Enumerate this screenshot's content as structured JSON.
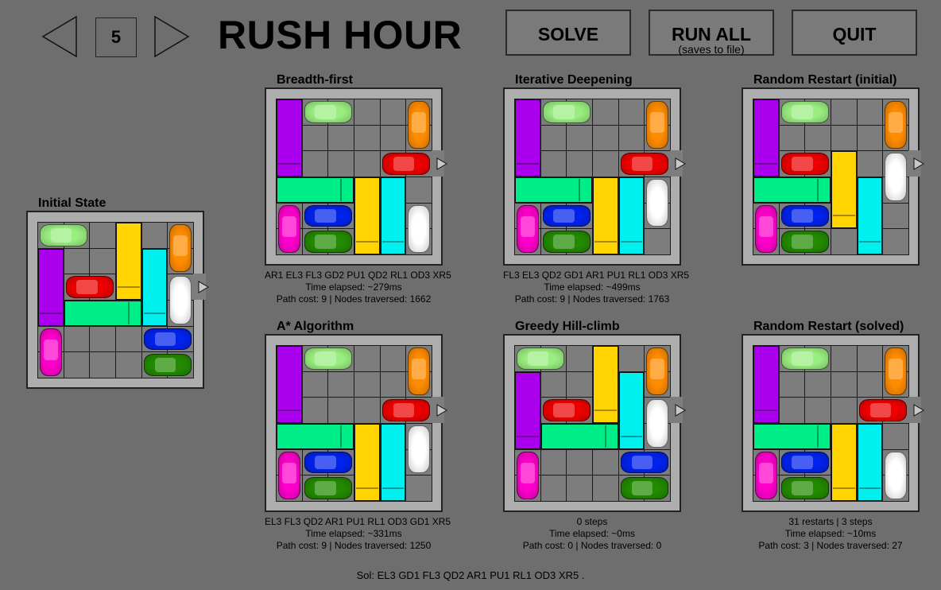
{
  "header": {
    "level": "5",
    "title": "RUSH HOUR",
    "prev_icon": "left-arrow-icon",
    "next_icon": "right-arrow-icon",
    "buttons": {
      "solve": "SOLVE",
      "run_all": "RUN ALL",
      "run_all_sub": "(saves to file)",
      "quit": "QUIT"
    }
  },
  "colors": {
    "X": "#ee0000",
    "A": "#9aee80",
    "B": "#ff8c00",
    "C": "#aa00ee",
    "D": "#ff00cc",
    "E": "#00ee88",
    "F": "#ffd400",
    "G": "#00f0f0",
    "H": "#ffffff",
    "I": "#0022ee",
    "J": "#228b00",
    "board_cell": "#7d7d7d",
    "board_frame": "#adadad",
    "background": "#6e6e6e"
  },
  "boards": [
    {
      "key": "initial",
      "title": "Initial State",
      "info": [],
      "pieces": [
        {
          "id": "A",
          "kind": "car",
          "r": 0,
          "c": 0,
          "o": "h",
          "len": 2
        },
        {
          "id": "C",
          "kind": "truck",
          "r": 1,
          "c": 0,
          "o": "v",
          "len": 3
        },
        {
          "id": "D",
          "kind": "car",
          "r": 4,
          "c": 0,
          "o": "v",
          "len": 2
        },
        {
          "id": "X",
          "kind": "car",
          "r": 2,
          "c": 1,
          "o": "h",
          "len": 2
        },
        {
          "id": "E",
          "kind": "truck",
          "r": 3,
          "c": 1,
          "o": "h",
          "len": 3
        },
        {
          "id": "F",
          "kind": "truck",
          "r": 0,
          "c": 3,
          "o": "v",
          "len": 3
        },
        {
          "id": "G",
          "kind": "truck",
          "r": 1,
          "c": 4,
          "o": "v",
          "len": 3
        },
        {
          "id": "B",
          "kind": "car",
          "r": 0,
          "c": 5,
          "o": "v",
          "len": 2
        },
        {
          "id": "H",
          "kind": "car",
          "r": 2,
          "c": 5,
          "o": "v",
          "len": 2
        },
        {
          "id": "I",
          "kind": "car",
          "r": 4,
          "c": 4,
          "o": "h",
          "len": 2
        },
        {
          "id": "J",
          "kind": "car",
          "r": 5,
          "c": 4,
          "o": "h",
          "len": 2
        }
      ]
    },
    {
      "key": "bfs",
      "title": "Breadth-first",
      "info": [
        "AR1 EL3 FL3 GD2 PU1 QD2 RL1 OD3 XR5",
        "Time elapsed: ~279ms",
        "Path cost: 9 | Nodes traversed: 1662"
      ],
      "pieces": [
        {
          "id": "C",
          "kind": "truck",
          "r": 0,
          "c": 0,
          "o": "v",
          "len": 3
        },
        {
          "id": "A",
          "kind": "car",
          "r": 0,
          "c": 1,
          "o": "h",
          "len": 2
        },
        {
          "id": "B",
          "kind": "car",
          "r": 0,
          "c": 5,
          "o": "v",
          "len": 2
        },
        {
          "id": "X",
          "kind": "car",
          "r": 2,
          "c": 4,
          "o": "h",
          "len": 2
        },
        {
          "id": "E",
          "kind": "truck",
          "r": 3,
          "c": 0,
          "o": "h",
          "len": 3
        },
        {
          "id": "F",
          "kind": "truck",
          "r": 3,
          "c": 3,
          "o": "v",
          "len": 3
        },
        {
          "id": "G",
          "kind": "truck",
          "r": 3,
          "c": 4,
          "o": "v",
          "len": 3
        },
        {
          "id": "D",
          "kind": "car",
          "r": 4,
          "c": 0,
          "o": "v",
          "len": 2
        },
        {
          "id": "I",
          "kind": "car",
          "r": 4,
          "c": 1,
          "o": "h",
          "len": 2
        },
        {
          "id": "J",
          "kind": "car",
          "r": 5,
          "c": 1,
          "o": "h",
          "len": 2
        },
        {
          "id": "H",
          "kind": "car",
          "r": 4,
          "c": 5,
          "o": "v",
          "len": 2
        }
      ]
    },
    {
      "key": "ids",
      "title": "Iterative Deepening",
      "info": [
        "FL3 EL3 QD2 GD1 AR1 PU1 RL1 OD3 XR5",
        "Time elapsed: ~499ms",
        "Path cost: 9 | Nodes traversed: 1763"
      ],
      "pieces": [
        {
          "id": "C",
          "kind": "truck",
          "r": 0,
          "c": 0,
          "o": "v",
          "len": 3
        },
        {
          "id": "A",
          "kind": "car",
          "r": 0,
          "c": 1,
          "o": "h",
          "len": 2
        },
        {
          "id": "B",
          "kind": "car",
          "r": 0,
          "c": 5,
          "o": "v",
          "len": 2
        },
        {
          "id": "X",
          "kind": "car",
          "r": 2,
          "c": 4,
          "o": "h",
          "len": 2
        },
        {
          "id": "E",
          "kind": "truck",
          "r": 3,
          "c": 0,
          "o": "h",
          "len": 3
        },
        {
          "id": "F",
          "kind": "truck",
          "r": 3,
          "c": 3,
          "o": "v",
          "len": 3
        },
        {
          "id": "G",
          "kind": "truck",
          "r": 3,
          "c": 4,
          "o": "v",
          "len": 3
        },
        {
          "id": "H",
          "kind": "car",
          "r": 3,
          "c": 5,
          "o": "v",
          "len": 2
        },
        {
          "id": "D",
          "kind": "car",
          "r": 4,
          "c": 0,
          "o": "v",
          "len": 2
        },
        {
          "id": "I",
          "kind": "car",
          "r": 4,
          "c": 1,
          "o": "h",
          "len": 2
        },
        {
          "id": "J",
          "kind": "car",
          "r": 5,
          "c": 1,
          "o": "h",
          "len": 2
        }
      ]
    },
    {
      "key": "rr_initial",
      "title": "Random Restart (initial)",
      "info": [],
      "pieces": [
        {
          "id": "C",
          "kind": "truck",
          "r": 0,
          "c": 0,
          "o": "v",
          "len": 3
        },
        {
          "id": "A",
          "kind": "car",
          "r": 0,
          "c": 1,
          "o": "h",
          "len": 2
        },
        {
          "id": "B",
          "kind": "car",
          "r": 0,
          "c": 5,
          "o": "v",
          "len": 2
        },
        {
          "id": "X",
          "kind": "car",
          "r": 2,
          "c": 1,
          "o": "h",
          "len": 2
        },
        {
          "id": "F",
          "kind": "truck",
          "r": 2,
          "c": 3,
          "o": "v",
          "len": 3
        },
        {
          "id": "H",
          "kind": "car",
          "r": 2,
          "c": 5,
          "o": "v",
          "len": 2
        },
        {
          "id": "E",
          "kind": "truck",
          "r": 3,
          "c": 0,
          "o": "h",
          "len": 3
        },
        {
          "id": "G",
          "kind": "truck",
          "r": 3,
          "c": 4,
          "o": "v",
          "len": 3
        },
        {
          "id": "D",
          "kind": "car",
          "r": 4,
          "c": 0,
          "o": "v",
          "len": 2
        },
        {
          "id": "I",
          "kind": "car",
          "r": 4,
          "c": 1,
          "o": "h",
          "len": 2
        },
        {
          "id": "J",
          "kind": "car",
          "r": 5,
          "c": 1,
          "o": "h",
          "len": 2
        }
      ]
    },
    {
      "key": "astar",
      "title": "A* Algorithm",
      "info": [
        "EL3 FL3 QD2 AR1 PU1 RL1 OD3 GD1 XR5",
        "Time elapsed: ~331ms",
        "Path cost: 9 | Nodes traversed: 1250"
      ],
      "pieces": [
        {
          "id": "C",
          "kind": "truck",
          "r": 0,
          "c": 0,
          "o": "v",
          "len": 3
        },
        {
          "id": "A",
          "kind": "car",
          "r": 0,
          "c": 1,
          "o": "h",
          "len": 2
        },
        {
          "id": "B",
          "kind": "car",
          "r": 0,
          "c": 5,
          "o": "v",
          "len": 2
        },
        {
          "id": "X",
          "kind": "car",
          "r": 2,
          "c": 4,
          "o": "h",
          "len": 2
        },
        {
          "id": "E",
          "kind": "truck",
          "r": 3,
          "c": 0,
          "o": "h",
          "len": 3
        },
        {
          "id": "F",
          "kind": "truck",
          "r": 3,
          "c": 3,
          "o": "v",
          "len": 3
        },
        {
          "id": "G",
          "kind": "truck",
          "r": 3,
          "c": 4,
          "o": "v",
          "len": 3
        },
        {
          "id": "H",
          "kind": "car",
          "r": 3,
          "c": 5,
          "o": "v",
          "len": 2
        },
        {
          "id": "D",
          "kind": "car",
          "r": 4,
          "c": 0,
          "o": "v",
          "len": 2
        },
        {
          "id": "I",
          "kind": "car",
          "r": 4,
          "c": 1,
          "o": "h",
          "len": 2
        },
        {
          "id": "J",
          "kind": "car",
          "r": 5,
          "c": 1,
          "o": "h",
          "len": 2
        }
      ]
    },
    {
      "key": "greedy",
      "title": "Greedy Hill-climb",
      "info": [
        "0 steps",
        "Time elapsed: ~0ms",
        "Path cost: 0 | Nodes traversed: 0"
      ],
      "pieces": [
        {
          "id": "A",
          "kind": "car",
          "r": 0,
          "c": 0,
          "o": "h",
          "len": 2
        },
        {
          "id": "C",
          "kind": "truck",
          "r": 1,
          "c": 0,
          "o": "v",
          "len": 3
        },
        {
          "id": "D",
          "kind": "car",
          "r": 4,
          "c": 0,
          "o": "v",
          "len": 2
        },
        {
          "id": "X",
          "kind": "car",
          "r": 2,
          "c": 1,
          "o": "h",
          "len": 2
        },
        {
          "id": "E",
          "kind": "truck",
          "r": 3,
          "c": 1,
          "o": "h",
          "len": 3
        },
        {
          "id": "F",
          "kind": "truck",
          "r": 0,
          "c": 3,
          "o": "v",
          "len": 3
        },
        {
          "id": "G",
          "kind": "truck",
          "r": 1,
          "c": 4,
          "o": "v",
          "len": 3
        },
        {
          "id": "B",
          "kind": "car",
          "r": 0,
          "c": 5,
          "o": "v",
          "len": 2
        },
        {
          "id": "H",
          "kind": "car",
          "r": 2,
          "c": 5,
          "o": "v",
          "len": 2
        },
        {
          "id": "I",
          "kind": "car",
          "r": 4,
          "c": 4,
          "o": "h",
          "len": 2
        },
        {
          "id": "J",
          "kind": "car",
          "r": 5,
          "c": 4,
          "o": "h",
          "len": 2
        }
      ]
    },
    {
      "key": "rr_solved",
      "title": "Random Restart (solved)",
      "info": [
        "31 restarts | 3 steps",
        "Time elapsed: ~10ms",
        "Path cost: 3 | Nodes traversed: 27"
      ],
      "pieces": [
        {
          "id": "C",
          "kind": "truck",
          "r": 0,
          "c": 0,
          "o": "v",
          "len": 3
        },
        {
          "id": "A",
          "kind": "car",
          "r": 0,
          "c": 1,
          "o": "h",
          "len": 2
        },
        {
          "id": "B",
          "kind": "car",
          "r": 0,
          "c": 5,
          "o": "v",
          "len": 2
        },
        {
          "id": "X",
          "kind": "car",
          "r": 2,
          "c": 4,
          "o": "h",
          "len": 2
        },
        {
          "id": "E",
          "kind": "truck",
          "r": 3,
          "c": 0,
          "o": "h",
          "len": 3
        },
        {
          "id": "F",
          "kind": "truck",
          "r": 3,
          "c": 3,
          "o": "v",
          "len": 3
        },
        {
          "id": "G",
          "kind": "truck",
          "r": 3,
          "c": 4,
          "o": "v",
          "len": 3
        },
        {
          "id": "D",
          "kind": "car",
          "r": 4,
          "c": 0,
          "o": "v",
          "len": 2
        },
        {
          "id": "I",
          "kind": "car",
          "r": 4,
          "c": 1,
          "o": "h",
          "len": 2
        },
        {
          "id": "J",
          "kind": "car",
          "r": 5,
          "c": 1,
          "o": "h",
          "len": 2
        },
        {
          "id": "H",
          "kind": "car",
          "r": 4,
          "c": 5,
          "o": "v",
          "len": 2
        }
      ]
    }
  ],
  "footer": {
    "solution": "Sol: EL3 GD1 FL3 QD2 AR1 PU1 RL1 OD3 XR5 ."
  }
}
